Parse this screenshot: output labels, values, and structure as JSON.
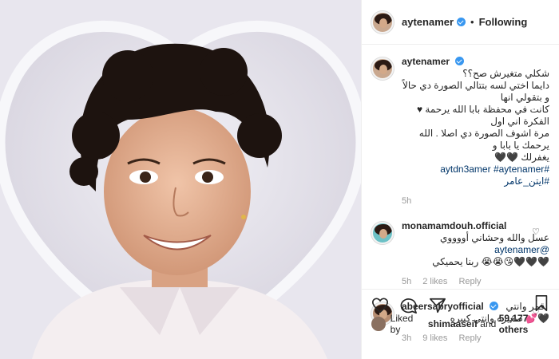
{
  "post": {
    "username": "aytenamer",
    "follow_label": "Following",
    "separator": "•"
  },
  "caption": {
    "username": "aytenamer",
    "text_lines": [
      "شكلي متغيرش صح؟؟",
      "دايما اختي لسه بتتالي الصورة دي حالاً و بتقولي انها",
      "كانت في محفظة بابا الله يرحمة ♥ الفكرة اني اول",
      "مرة اشوف الصورة دي اصلا . الله يرحمك يا بابا و",
      "يغفرلك 🖤🖤"
    ],
    "hashtags": [
      "#ايتن_عامر",
      "#aytenamer",
      "#aytdn3amer"
    ],
    "time": "5h"
  },
  "comments": [
    {
      "username": "monamamdouh.official",
      "mention": "@aytenamer",
      "text_lines": [
        "عسل والله وحشاني أووووي",
        "🖤🖤🖤😘😭😭 ربنا يحميكي"
      ],
      "time": "5h",
      "likes": "2 likes",
      "reply": "Reply"
    },
    {
      "username": "abeersabryofficial",
      "text_lines": [
        "قمر وانتي",
        "🖤💕 صغيره وانتي كبيره"
      ],
      "time": "3h",
      "likes": "9 likes",
      "reply": "Reply"
    }
  ],
  "likes_line": {
    "prefix": "Liked by",
    "user": "shimaaseif",
    "joiner": "and",
    "count": "59,177 others"
  }
}
